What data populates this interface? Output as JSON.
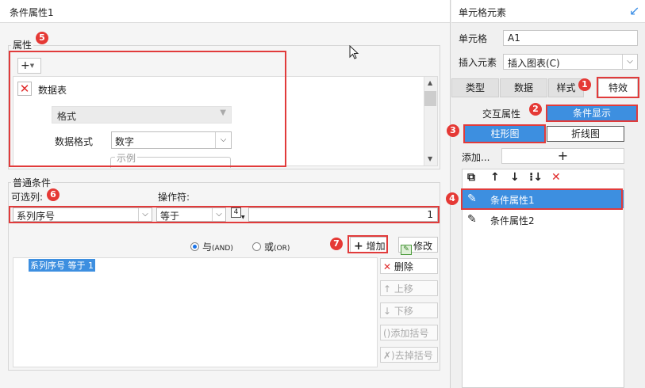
{
  "dialog": {
    "title": "条件属性1",
    "attr_group": {
      "label": "属性",
      "add_icon": "plus-icon",
      "item_name": "数据表",
      "format_label": "格式",
      "data_format_label": "数据格式",
      "data_format_value": "数字",
      "example_label": "示例"
    },
    "cond_group": {
      "label": "普通条件",
      "column_label": "可选列:",
      "operator_label": "操作符:",
      "column_value": "系列序号",
      "operator_value": "等于",
      "value_type_glyph": "4",
      "value": "1",
      "radio_and": "与",
      "radio_and_en": "(AND)",
      "radio_or": "或",
      "radio_or_en": "(OR)",
      "add_button": "增加",
      "modify_button": "修改",
      "list_items": [
        "系列序号 等于 1"
      ],
      "side_buttons": {
        "delete": "删除",
        "up": "上移",
        "down": "下移",
        "add_paren": "添加括号",
        "remove_paren": "去掉括号"
      }
    }
  },
  "right_panel": {
    "title": "单元格元素",
    "cell_label": "单元格",
    "cell_value": "A1",
    "insert_label": "插入元素",
    "insert_value": "插入图表(C)",
    "tabs": [
      "类型",
      "数据",
      "样式",
      "特效"
    ],
    "sub_tabs": [
      "交互属性",
      "条件显示"
    ],
    "chart_tabs": [
      "柱形图",
      "折线图"
    ],
    "add_label": "添加...",
    "list_items": [
      "条件属性1",
      "条件属性2"
    ]
  },
  "badges": [
    "1",
    "2",
    "3",
    "4",
    "5",
    "6",
    "7"
  ],
  "colors": {
    "accent": "#3d8fe0",
    "highlight_box": "#e13b3b",
    "delete_red": "#e02b2b"
  }
}
